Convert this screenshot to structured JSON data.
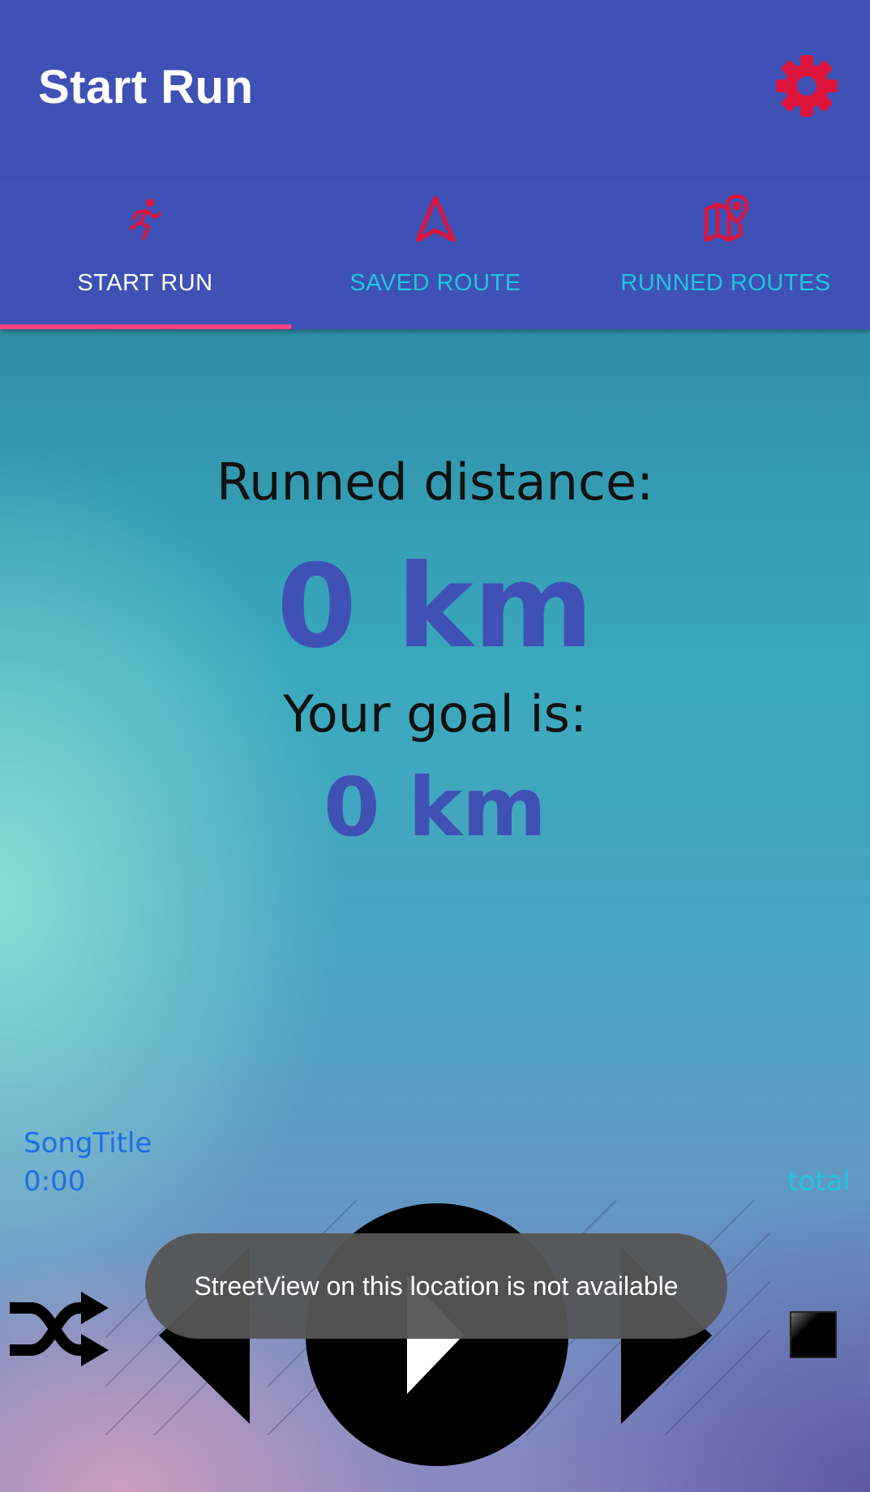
{
  "app_bar": {
    "title": "Start Run",
    "settings_icon": "gear-icon",
    "settings_icon_color": "#dc143c",
    "background": "#3f51b5"
  },
  "tabs": [
    {
      "label": "START RUN",
      "icon": "runner-icon",
      "active": true
    },
    {
      "label": "SAVED ROUTE",
      "icon": "navigation-arrow-icon",
      "active": false
    },
    {
      "label": "RUNNED ROUTES",
      "icon": "map-pin-icon",
      "active": false
    }
  ],
  "tab_colors": {
    "active_label": "#ffffff",
    "inactive_label": "#1ec6e0",
    "icon": "#dc143c",
    "indicator": "#ff4081"
  },
  "run_stats": {
    "distance_label": "Runned distance:",
    "distance_value": "0 km",
    "goal_label": "Your goal is:",
    "goal_value": "0 km",
    "value_color": "#3f51b5"
  },
  "player": {
    "song_title": "SongTitle",
    "current_time": "0:00",
    "total_time": "total",
    "shuffle_icon": "shuffle-icon",
    "previous_icon": "previous-icon",
    "play_icon": "play-icon",
    "next_icon": "next-icon",
    "stop_icon": "stop-icon"
  },
  "toast": {
    "message": "StreetView on this location is not available"
  }
}
